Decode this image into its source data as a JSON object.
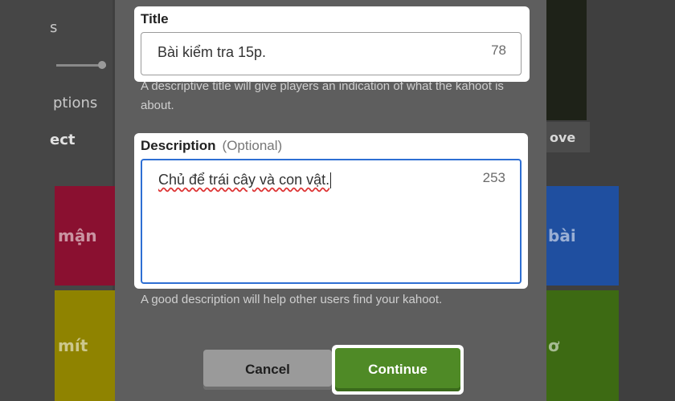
{
  "background": {
    "left_fragments": [
      "s",
      "ptions",
      "ect"
    ],
    "tiles_left": [
      "mận",
      "mít"
    ],
    "tiles_right": [
      "bài",
      "ơ"
    ],
    "right_button_fragment": "ove",
    "tile_colors": {
      "red": "#8a1030",
      "blue": "#1f4fa0",
      "yellow": "#8f8300",
      "green": "#3d6a13"
    }
  },
  "modal": {
    "title_field": {
      "label": "Title",
      "value": "Bài kiểm tra 15p.",
      "remaining": "78",
      "helper": "A descriptive title will give players an indication of what the kahoot is about."
    },
    "description_field": {
      "label": "Description",
      "optional_label": "(Optional)",
      "value": "Chủ để trái cây và con vật.",
      "remaining": "253",
      "helper": "A good description will help other users find your kahoot."
    },
    "buttons": {
      "cancel": "Cancel",
      "continue": "Continue"
    },
    "colors": {
      "continue_green": "#4f8a26",
      "focus_blue": "#2e6fd3"
    }
  }
}
